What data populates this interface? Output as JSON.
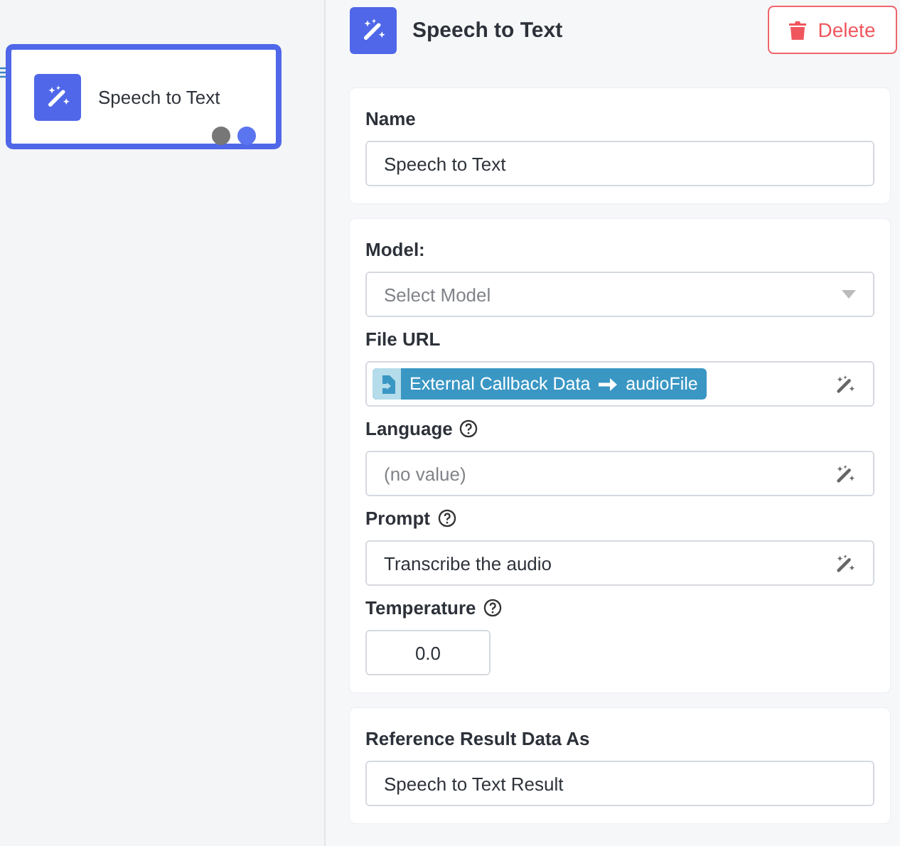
{
  "canvas": {
    "node": {
      "title": "Speech to Text",
      "selected": true
    }
  },
  "panel": {
    "title": "Speech to Text",
    "delete_button": "Delete",
    "sections": [
      {
        "fields": [
          {
            "kind": "text",
            "label": "Name",
            "help": false,
            "value": "Speech to Text"
          }
        ]
      },
      {
        "fields": [
          {
            "kind": "select",
            "label": "Model:",
            "help": false,
            "placeholder": "Select Model"
          },
          {
            "kind": "reference",
            "label": "File URL",
            "help": false,
            "source": "External Callback Data",
            "target": "audioFile"
          },
          {
            "kind": "magic",
            "label": "Language",
            "help": true,
            "placeholder": "(no value)"
          },
          {
            "kind": "magic",
            "label": "Prompt",
            "help": true,
            "value": "Transcribe the audio"
          },
          {
            "kind": "number",
            "label": "Temperature",
            "help": true,
            "value": "0.0"
          }
        ]
      },
      {
        "fields": [
          {
            "kind": "text",
            "label": "Reference Result Data As",
            "help": false,
            "value": "Speech to Text Result"
          }
        ]
      }
    ]
  }
}
